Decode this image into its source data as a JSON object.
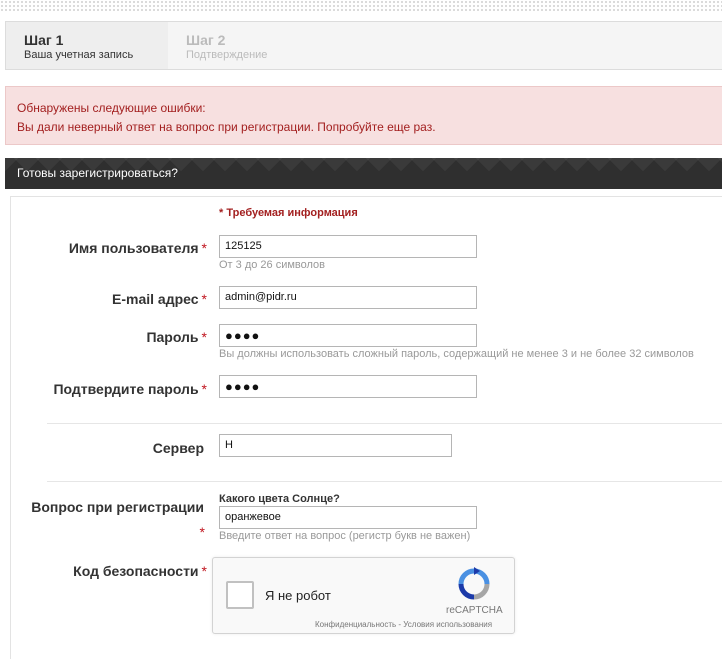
{
  "steps": [
    {
      "title": "Шаг 1",
      "subtitle": "Ваша учетная запись"
    },
    {
      "title": "Шаг 2",
      "subtitle": "Подтверждение"
    }
  ],
  "errors": {
    "heading": "Обнаружены следующие ошибки:",
    "message": "Вы дали неверный ответ на вопрос при регистрации. Попробуйте еще раз."
  },
  "form": {
    "header": "Готовы зарегистрироваться?",
    "required_note": "* Требуемая информация",
    "required_star": "*",
    "username": {
      "label": "Имя пользователя",
      "value": "125125",
      "hint": "От 3 до 26 символов"
    },
    "email": {
      "label": "E-mail адрес",
      "value": "admin@pidr.ru"
    },
    "password": {
      "label": "Пароль",
      "value": "●●●●",
      "hint": "Вы должны использовать сложный пароль, содержащий не менее 3 и не более 32 символов"
    },
    "confirm_password": {
      "label": "Подтвердите пароль",
      "value": "●●●●"
    },
    "server": {
      "label": "Сервер",
      "value": "Н"
    },
    "security_question": {
      "label": "Вопрос при регистрации",
      "question": "Какого цвета Солнце?",
      "value": "оранжевое",
      "hint": "Введите ответ на вопрос (регистр букв не важен)"
    },
    "security_code": {
      "label": "Код безопасности"
    }
  },
  "captcha": {
    "label": "Я не робот",
    "brand": "reCAPTCHA",
    "links": "Конфиденциальность - Условия использования"
  },
  "colors": {
    "error_text": "#a32020",
    "error_bg": "#f7e0e0",
    "header_bg": "#2f2f2f",
    "required_star": "#c0141e"
  }
}
